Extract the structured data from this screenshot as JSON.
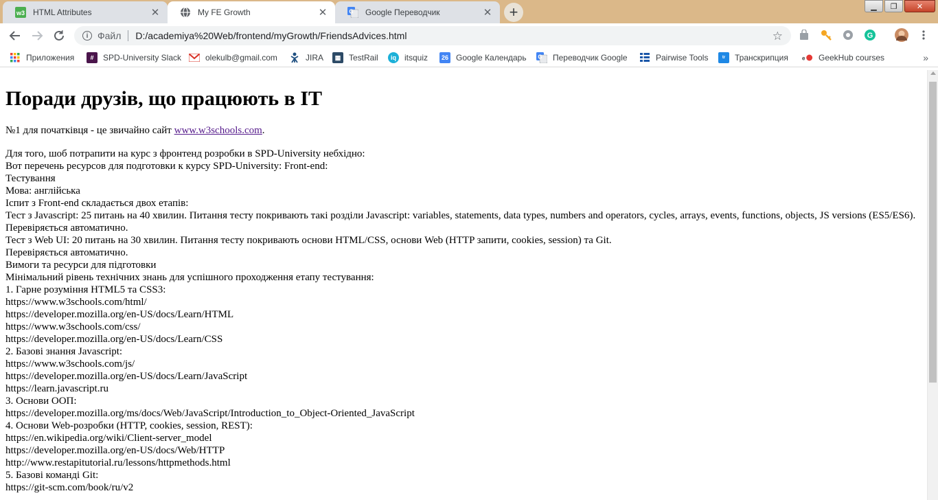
{
  "browser": {
    "tabs": [
      {
        "title": "HTML Attributes",
        "icon": "w3schools-favicon",
        "close": "✕"
      },
      {
        "title": "My FE Growth",
        "icon": "globe-icon",
        "close": "✕"
      },
      {
        "title": "Google Переводчик",
        "icon": "google-translate-icon",
        "close": "✕"
      }
    ],
    "new_tab": "+",
    "window_buttons": {
      "minimize": "▁",
      "maximize": "❐",
      "close": "✕"
    },
    "address_bar": {
      "scheme_label": "Файл",
      "url": "D:/academiya%20Web/frontend/myGrowth/FriendsAdvices.html"
    },
    "bookmarks": [
      {
        "label": "Приложения",
        "icon": "apps-grid-icon",
        "color": "#e8453c"
      },
      {
        "label": "SPD-University Slack",
        "icon": "slack-icon",
        "color": "#4a154b"
      },
      {
        "label": "olekulb@gmail.com",
        "icon": "gmail-icon",
        "color": "#d93025"
      },
      {
        "label": "JIRA",
        "icon": "jira-icon",
        "color": "#205081"
      },
      {
        "label": "TestRail",
        "icon": "testrail-icon",
        "color": "#3a5a7a"
      },
      {
        "label": "itsquiz",
        "icon": "itsquiz-icon",
        "color": "#1cb0d8"
      },
      {
        "label": "Google Календарь",
        "icon": "calendar-icon",
        "color": "#4285f4",
        "icon_text": "26"
      },
      {
        "label": "Переводчик Google",
        "icon": "google-translate-icon",
        "color": "#4285f4"
      },
      {
        "label": "Pairwise Tools",
        "icon": "pairwise-icon",
        "color": "#1a56a8"
      },
      {
        "label": "Транскрипция",
        "icon": "transcription-icon",
        "color": "#1e88e5"
      },
      {
        "label": "GeekHub courses",
        "icon": "geekhub-icon",
        "color": "#e53935"
      }
    ],
    "bookmarks_more": "»"
  },
  "page": {
    "title": "Поради друзів, що працюють в IT",
    "intro_before": "№1 для початківця - це звичайно сайт ",
    "intro_link": "www.w3schools.com",
    "intro_after": ".",
    "lines": [
      "Для того, шоб потрапити на курс з фронтенд розробки в SPD-University небхідно:",
      "Вот перечень ресурсов для подготовки к курсу SPD-University: Front-end:",
      "Тестування",
      "Мова: англійська",
      "Іспит з Front-end складається двох етапів:",
      "Тест з Javascript: 25 питань на 40 хвилин. Питання тесту покривають такі розділи Javascript: variables, statements, data types, numbers and operators, cycles, arrays, events, functions, objects, JS versions (ES5/ES6).",
      "Перевіряється автоматично.",
      "Тест з Web UI: 20 питань на 30 хвилин. Питання тесту покривають основи HTML/CSS, основи Web (HTTP запити, cookies, session) та Git.",
      "Перевіряється автоматично.",
      "Вимоги та ресурси для підготовки",
      "Мінімальний рівень технічних знань для успішного проходження етапу тестування:",
      "1. Гарне розуміння HTML5 та CSS3:",
      "https://www.w3schools.com/html/",
      "https://developer.mozilla.org/en-US/docs/Learn/HTML",
      "https://www.w3schools.com/css/",
      "https://developer.mozilla.org/en-US/docs/Learn/CSS",
      "2. Базові знання Javascript:",
      "https://www.w3schools.com/js/",
      "https://developer.mozilla.org/en-US/docs/Learn/JavaScript",
      "https://learn.javascript.ru",
      "3. Основи ООП:",
      "https://developer.mozilla.org/ms/docs/Web/JavaScript/Introduction_to_Object-Oriented_JavaScript",
      "4. Основи Web-розробки (HTTP, cookies, session, REST):",
      "https://en.wikipedia.org/wiki/Client-server_model",
      "https://developer.mozilla.org/en-US/docs/Web/HTTP",
      "http://www.restapitutorial.ru/lessons/httpmethods.html",
      "5. Базові команді Git:",
      "https://git-scm.com/book/ru/v2"
    ]
  }
}
